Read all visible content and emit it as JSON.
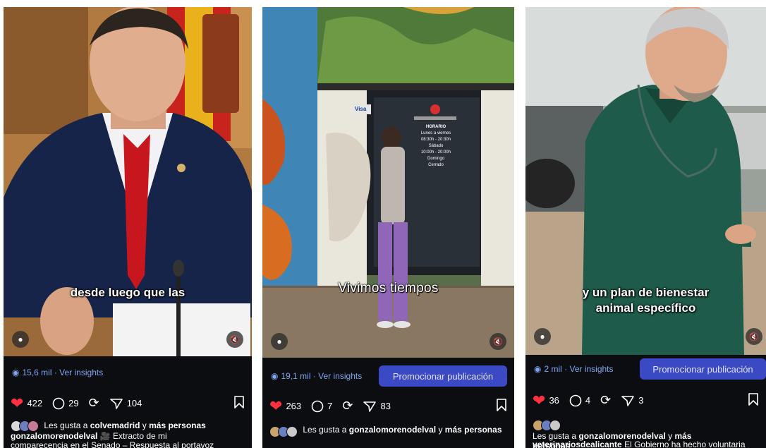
{
  "posts": [
    {
      "caption": "desde luego que las",
      "views": "15,6 mil · Ver insights",
      "promote": "",
      "likes_count": "422",
      "comments_count": "29",
      "shares_count": "104",
      "liked_by_prefix": "Les gusta a",
      "liked_by_user": "colvemadrid",
      "liked_by_connector": "y",
      "liked_by_more": "más personas",
      "author": "gonzalomorenodelval",
      "description_line1": "Extracto de mi",
      "description_line2": "comparecencia en el Senado – Respuesta al portavoz"
    },
    {
      "caption": "Vivimos tiempos",
      "views": "19,1 mil · Ver insights",
      "promote": "Promocionar publicación",
      "likes_count": "263",
      "comments_count": "7",
      "shares_count": "83",
      "liked_by_prefix": "Les gusta a",
      "liked_by_user": "gonzalomorenodelval",
      "liked_by_connector": "y",
      "liked_by_more": "más personas",
      "sign_hours": [
        "HORARIO",
        "Lunes a viernes",
        "08:30h - 20:30h",
        "Sábado",
        "10:00h - 20:00h",
        "Domingo",
        "Cerrado"
      ],
      "sign_visa": "Visa"
    },
    {
      "caption_line1": "y un plan de bienestar",
      "caption_line2": "animal específico",
      "views": "2 mil · Ver insights",
      "promote": "Promocionar publicación",
      "likes_count": "36",
      "comments_count": "4",
      "shares_count": "3",
      "liked_by_prefix": "Les gusta a",
      "liked_by_user": "gonzalomorenodelval",
      "liked_by_connector": "y",
      "liked_by_more": "más personas",
      "author": "veterinariosdealicante",
      "description_line1": "El Gobierno ha hecho voluntaria"
    }
  ],
  "icons": {
    "eye": "eye-icon",
    "heart": "heart-icon",
    "comment": "comment-icon",
    "repost": "repost-icon",
    "send": "send-icon",
    "bookmark": "bookmark-icon",
    "user": "user-icon",
    "mute": "muted-speaker-icon"
  },
  "colors": {
    "background": "#0c0d10",
    "heart": "#ff3040",
    "insights_link": "#7ea6f2",
    "promote_button": "#3b49c5"
  }
}
